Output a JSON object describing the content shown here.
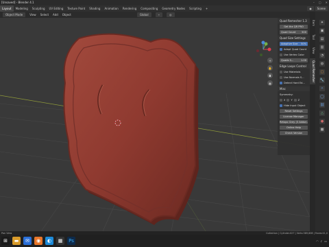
{
  "window": {
    "title": "[Unsaved] - Blender 4.1",
    "controls": [
      "–",
      "▢",
      "✕"
    ]
  },
  "workspaces": [
    "Layout",
    "Modeling",
    "Sculpting",
    "UV Editing",
    "Texture Paint",
    "Shading",
    "Animation",
    "Rendering",
    "Compositing",
    "Geometry Nodes",
    "Scripting",
    "+"
  ],
  "active_workspace_index": 0,
  "top_right": {
    "scene_label": "Scene"
  },
  "header": {
    "mode": "Object Mode",
    "view": "View",
    "select": "Select",
    "add": "Add",
    "object": "Object",
    "orientation": "Global"
  },
  "n_panel": {
    "tabs": [
      "Item",
      "Tool",
      "View",
      "Quad Remesher"
    ],
    "active_tab": 3,
    "title": "Quad Remesher 1.3",
    "license_btn": "Get the QR PRO",
    "quad_count_label": "Quad Count",
    "quad_count_value": "500",
    "quad_size_header": "Quad Size Settings",
    "adaptive_label": "Adaptive Size",
    "adaptive_value": "50%",
    "adapt_quad_count": "Adapt Quad Count",
    "use_vertex_color": "Use Vertex Color",
    "quads_scale_label": "Quads S...",
    "quads_scale_value": "1.00",
    "edge_loops_header": "Edge Loops Control",
    "use_materials": "Use Materials",
    "use_normals": "Use Normals S...",
    "detect_hard": "Detect Hard Ed...",
    "misc_header": "Misc",
    "symmetry_label": "Symmetry:",
    "sym_x": "X",
    "sym_y": "Y",
    "sym_z": "Z",
    "hide_input": "Hide Input Object",
    "buttons": [
      "Reset Settings",
      "License Manager",
      "Retopo Grey (3 Addon...",
      "Online Help",
      "Check Version"
    ]
  },
  "status": {
    "left": "Pan View",
    "right": "Collection | Cylinder.027 | Verts:389,608 | Faces:41,0"
  },
  "taskbar_icons": [
    "start",
    "files",
    "mail",
    "blender",
    "edge",
    "calc",
    "ps"
  ],
  "tray": {
    "time": "",
    "lang": ""
  },
  "colors": {
    "shield": "#8f3a30",
    "shield_dark": "#5e241d",
    "viewport": "#393939",
    "accent": "#4772b3"
  }
}
